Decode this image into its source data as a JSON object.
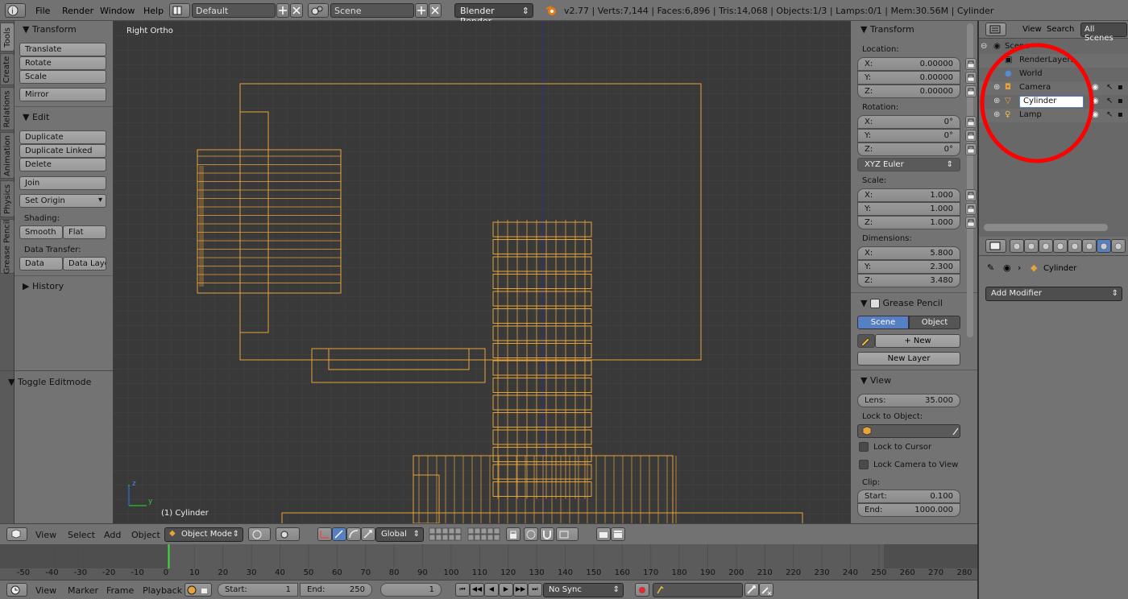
{
  "topbar": {
    "menus": [
      "File",
      "Render",
      "Window",
      "Help"
    ],
    "layout": "Default",
    "scene": "Scene",
    "engine": "Blender Render",
    "info": "v2.77 | Verts:7,144 | Faces:6,896 | Tris:14,068 | Objects:1/3 | Lamps:0/1 | Mem:30.56M | Cylinder"
  },
  "lefttabs": [
    "Tools",
    "Create",
    "Relations",
    "Animation",
    "Physics",
    "Grease Pencil"
  ],
  "tools": {
    "transform_title": "Transform",
    "translate": "Translate",
    "rotate": "Rotate",
    "scale": "Scale",
    "mirror": "Mirror",
    "edit_title": "Edit",
    "duplicate": "Duplicate",
    "duplicate_linked": "Duplicate Linked",
    "delete": "Delete",
    "join": "Join",
    "set_origin": "Set Origin",
    "shading_label": "Shading:",
    "smooth": "Smooth",
    "flat": "Flat",
    "data_transfer_label": "Data Transfer:",
    "data": "Data",
    "data_layout": "Data Layo",
    "history_title": "History",
    "toggle_editmode": "Toggle Editmode"
  },
  "viewport": {
    "view_name": "Right Ortho",
    "object_label": "(1) Cylinder",
    "axis_z": "z",
    "axis_y": "y"
  },
  "npanel": {
    "transform_title": "Transform",
    "location_label": "Location:",
    "location": [
      {
        "axis": "X:",
        "value": "0.00000"
      },
      {
        "axis": "Y:",
        "value": "0.00000"
      },
      {
        "axis": "Z:",
        "value": "0.00000"
      }
    ],
    "rotation_label": "Rotation:",
    "rotation": [
      {
        "axis": "X:",
        "value": "0°"
      },
      {
        "axis": "Y:",
        "value": "0°"
      },
      {
        "axis": "Z:",
        "value": "0°"
      }
    ],
    "rotation_mode": "XYZ Euler",
    "scale_label": "Scale:",
    "scale": [
      {
        "axis": "X:",
        "value": "1.000"
      },
      {
        "axis": "Y:",
        "value": "1.000"
      },
      {
        "axis": "Z:",
        "value": "1.000"
      }
    ],
    "dimensions_label": "Dimensions:",
    "dimensions": [
      {
        "axis": "X:",
        "value": "5.800"
      },
      {
        "axis": "Y:",
        "value": "2.300"
      },
      {
        "axis": "Z:",
        "value": "3.480"
      }
    ],
    "grease_pencil_title": "Grease Pencil",
    "gp_scene": "Scene",
    "gp_object": "Object",
    "gp_new": "New",
    "gp_new_layer": "New Layer",
    "view_title": "View",
    "lens_label": "Lens:",
    "lens_value": "35.000",
    "lock_to_object_label": "Lock to Object:",
    "lock_to_cursor": "Lock to Cursor",
    "lock_camera_to_view": "Lock Camera to View",
    "clip_label": "Clip:",
    "clip_start_label": "Start:",
    "clip_start": "0.100",
    "clip_end_label": "End:",
    "clip_end": "1000.000"
  },
  "outliner": {
    "view": "View",
    "search": "Search",
    "all_scenes": "All Scenes",
    "items": {
      "scene": "Scene",
      "renderlayers": "RenderLayers",
      "world": "World",
      "camera": "Camera",
      "cylinder": "Cylinder",
      "lamp": "Lamp"
    }
  },
  "properties": {
    "object_name": "Cylinder",
    "add_modifier": "Add Modifier"
  },
  "viewheader": {
    "view": "View",
    "select": "Select",
    "add": "Add",
    "object": "Object",
    "mode": "Object Mode",
    "orientation": "Global"
  },
  "timeline": {
    "ticks": [
      -50,
      -40,
      -30,
      -20,
      -10,
      0,
      10,
      20,
      30,
      40,
      50,
      60,
      70,
      80,
      90,
      100,
      110,
      120,
      130,
      140,
      150,
      160,
      170,
      180,
      190,
      200,
      210,
      220,
      230,
      240,
      250,
      260,
      270,
      280
    ],
    "current_frame": 1,
    "view": "View",
    "marker": "Marker",
    "frame": "Frame",
    "playback": "Playback",
    "start_label": "Start:",
    "start": "1",
    "end_label": "End:",
    "end": "250",
    "frame_value": "1",
    "sync": "No Sync"
  },
  "colors": {
    "wire": "#e8a33a",
    "highlight_circle": "#ff0000",
    "accent_blue": "#5680c2"
  }
}
